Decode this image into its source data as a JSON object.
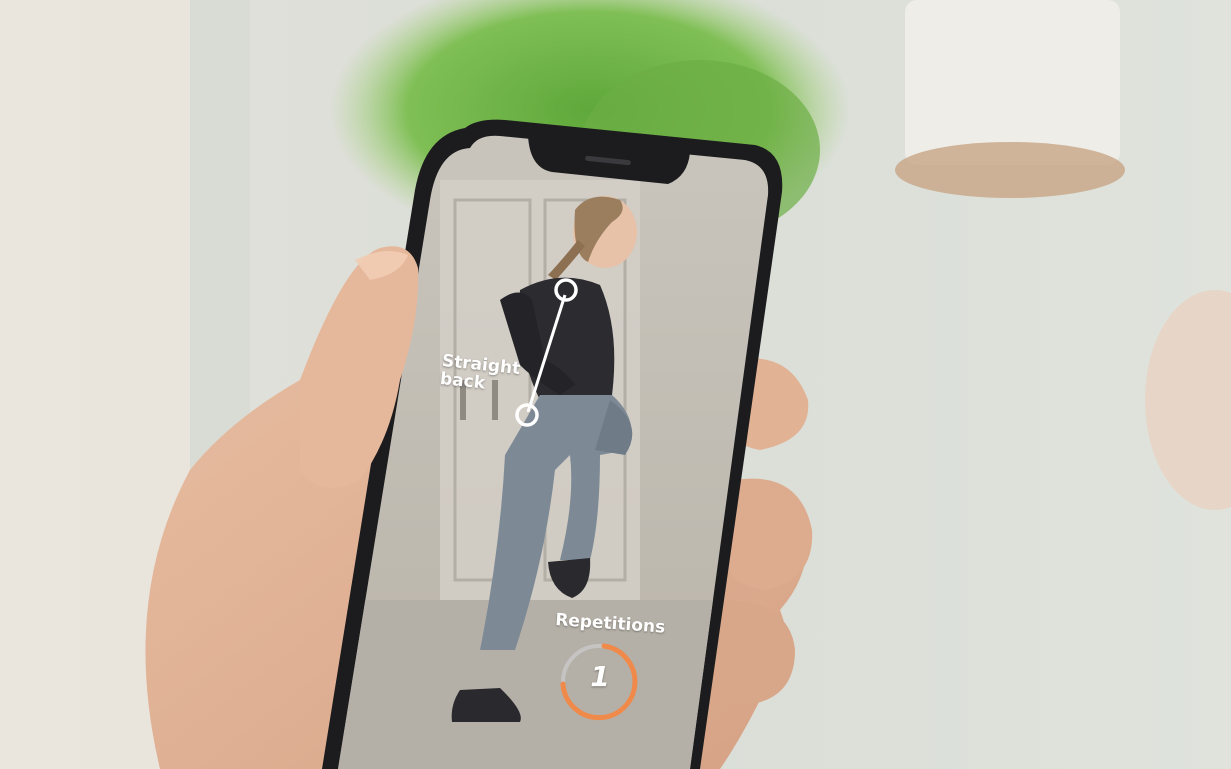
{
  "overlay": {
    "posture_label_line1": "Straight",
    "posture_label_line2": "back",
    "counter_label": "Repetitions",
    "counter_value": "1"
  },
  "colors": {
    "accent_orange": "#EF8A4A",
    "ring_track": "#C8C8C8",
    "overlay_white": "#FFFFFF"
  },
  "icons": {
    "posture_guide": "joint-line-icon",
    "repetition_ring": "progress-ring-icon"
  }
}
